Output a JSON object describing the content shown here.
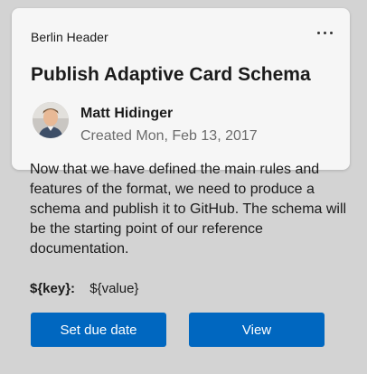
{
  "header": {
    "label": "Berlin Header",
    "more_icon": "ellipsis-icon"
  },
  "card": {
    "title": "Publish Adaptive Card Schema",
    "author": {
      "name": "Matt Hidinger",
      "created": "Created Mon, Feb 13, 2017",
      "avatar_icon": "avatar-photo"
    },
    "body": "Now that we have defined the main rules and features of the format, we need to produce a schema and publish it to GitHub. The schema will be the starting point of our reference documentation.",
    "fact": {
      "key": "${key}:",
      "value": "${value}"
    }
  },
  "actions": {
    "set_due_date_label": "Set due date",
    "view_label": "View"
  },
  "colors": {
    "background": "#d3d3d3",
    "header_card": "#f6f6f6",
    "button": "#0067c0",
    "subtle_text": "#6b6b6b"
  }
}
